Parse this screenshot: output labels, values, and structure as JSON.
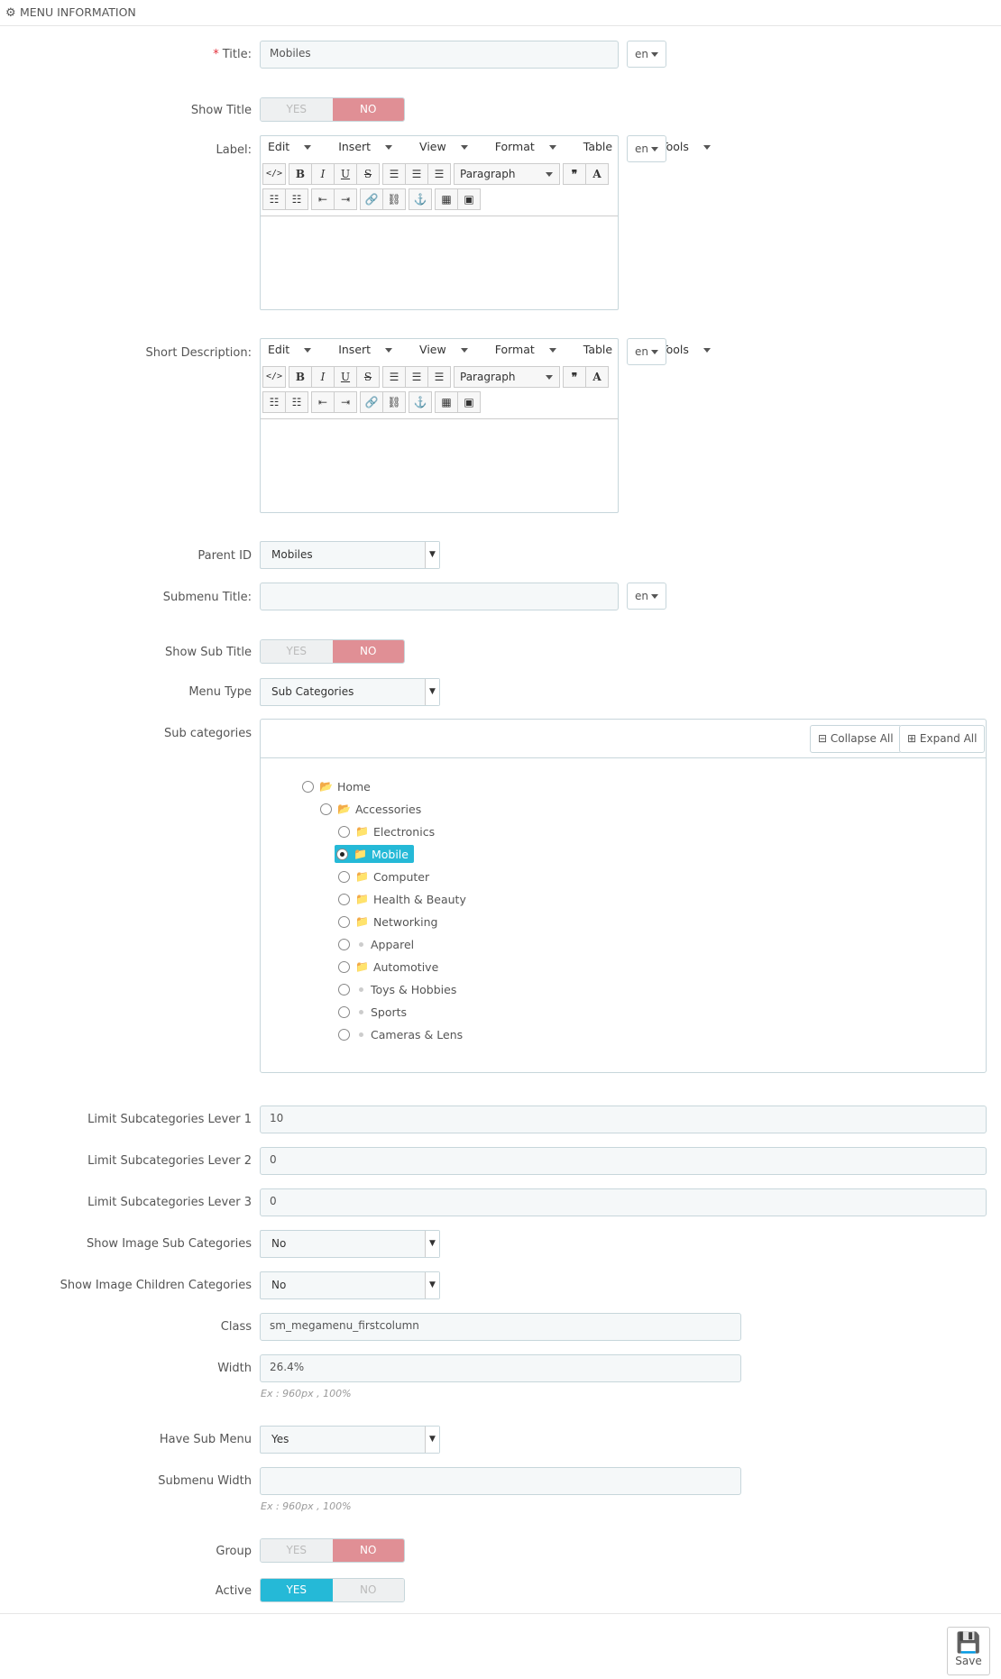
{
  "header": {
    "title": "MENU INFORMATION"
  },
  "lang_code": "en",
  "fields": {
    "title": {
      "label": "Title:",
      "value": "Mobiles"
    },
    "show_title": {
      "label": "Show Title",
      "yes": "YES",
      "no": "NO",
      "state": "no"
    },
    "label": {
      "label": "Label:"
    },
    "short_description": {
      "label": "Short Description:"
    },
    "parent_id": {
      "label": "Parent ID",
      "value": "Mobiles"
    },
    "submenu_title": {
      "label": "Submenu Title:",
      "value": ""
    },
    "show_sub_title": {
      "label": "Show Sub Title",
      "yes": "YES",
      "no": "NO",
      "state": "no"
    },
    "menu_type": {
      "label": "Menu Type",
      "value": "Sub Categories"
    },
    "sub_categories": {
      "label": "Sub categories"
    },
    "limit_1": {
      "label": "Limit Subcategories Lever 1",
      "value": "10"
    },
    "limit_2": {
      "label": "Limit Subcategories Lever 2",
      "value": "0"
    },
    "limit_3": {
      "label": "Limit Subcategories Lever 3",
      "value": "0"
    },
    "show_image_sub": {
      "label": "Show Image Sub Categories",
      "value": "No"
    },
    "show_image_children": {
      "label": "Show Image Children Categories",
      "value": "No"
    },
    "class": {
      "label": "Class",
      "value": "sm_megamenu_firstcolumn"
    },
    "width": {
      "label": "Width",
      "value": "26.4%",
      "help": "Ex : 960px , 100%"
    },
    "have_sub_menu": {
      "label": "Have Sub Menu",
      "value": "Yes"
    },
    "submenu_width": {
      "label": "Submenu Width",
      "value": "",
      "help": "Ex : 960px , 100%"
    },
    "group": {
      "label": "Group",
      "yes": "YES",
      "no": "NO",
      "state": "no"
    },
    "active": {
      "label": "Active",
      "yes": "YES",
      "no": "NO",
      "state": "yes"
    }
  },
  "editor": {
    "menus": [
      "Edit",
      "Insert",
      "View",
      "Format",
      "Table",
      "Tools"
    ],
    "block_format": "Paragraph",
    "tools_row1": [
      "</>",
      "B",
      "I",
      "U",
      "S",
      "≡",
      "≡",
      "≡"
    ],
    "tools_row2": [
      "list",
      "numlist",
      "outdent",
      "indent",
      "link",
      "unlink",
      "anchor",
      "media",
      "image"
    ]
  },
  "tree": {
    "collapse_label": "Collapse All",
    "expand_label": "Expand All",
    "items": [
      {
        "label": "Home",
        "level": 0,
        "type": "folder-open"
      },
      {
        "label": "Accessories",
        "level": 1,
        "type": "folder-open"
      },
      {
        "label": "Electronics",
        "level": 2,
        "type": "folder"
      },
      {
        "label": "Mobile",
        "level": 2,
        "type": "folder",
        "selected": true
      },
      {
        "label": "Computer",
        "level": 2,
        "type": "folder"
      },
      {
        "label": "Health & Beauty",
        "level": 2,
        "type": "folder"
      },
      {
        "label": "Networking",
        "level": 2,
        "type": "folder"
      },
      {
        "label": "Apparel",
        "level": 2,
        "type": "leaf"
      },
      {
        "label": "Automotive",
        "level": 2,
        "type": "folder"
      },
      {
        "label": "Toys & Hobbies",
        "level": 2,
        "type": "leaf"
      },
      {
        "label": "Sports",
        "level": 2,
        "type": "leaf"
      },
      {
        "label": "Cameras & Lens",
        "level": 2,
        "type": "leaf"
      }
    ]
  },
  "footer": {
    "save_label": "Save"
  }
}
